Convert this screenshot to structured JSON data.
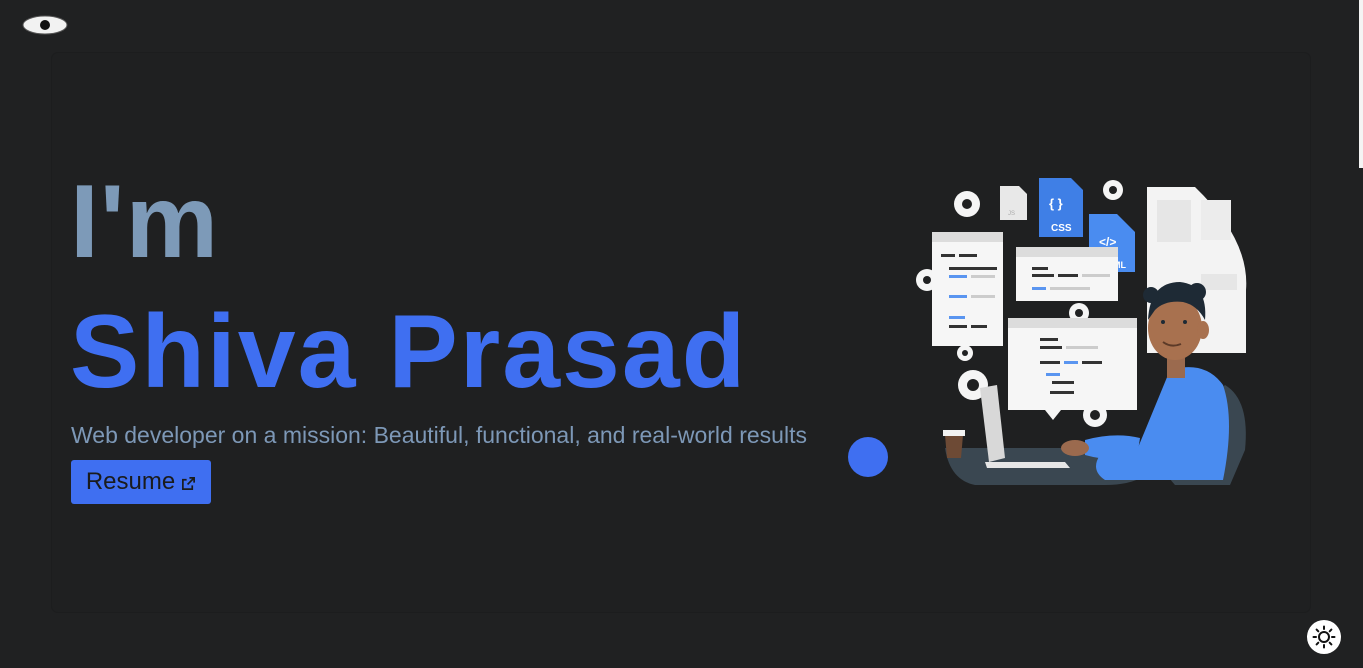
{
  "hero": {
    "intro": "I'm",
    "name": "Shiva Prasad",
    "tagline": "Web developer on a mission: Beautiful, functional, and real-world results",
    "resume_label": "Resume"
  },
  "illustration": {
    "css_label": "CSS",
    "css_braces": "{ }",
    "html_tag": "</>",
    "html_label_partial": "ML",
    "js_label": "JS"
  },
  "icons": {
    "logo": "eye-icon",
    "external": "external-link-icon",
    "theme": "sun-icon"
  },
  "colors": {
    "background": "#202122",
    "accent": "#3f6ff1",
    "muted": "#7d9ab8"
  }
}
